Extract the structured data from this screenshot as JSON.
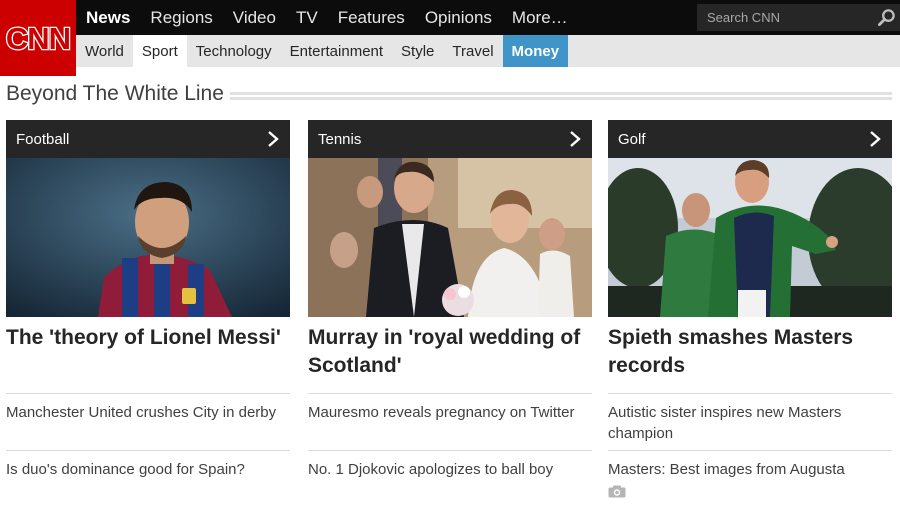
{
  "brand": {
    "logo_text": "CNN",
    "accent": "#cc0000"
  },
  "primary_nav": [
    "News",
    "Regions",
    "Video",
    "TV",
    "Features",
    "Opinions",
    "More…"
  ],
  "search": {
    "placeholder": "Search CNN"
  },
  "secondary_nav": [
    "World",
    "Sport",
    "Technology",
    "Entertainment",
    "Style",
    "Travel",
    "Money"
  ],
  "section": {
    "title": "Beyond The White Line"
  },
  "columns": [
    {
      "category": "Football",
      "headline": "The 'theory of Lionel Messi'",
      "stories": [
        "Manchester United crushes City in derby",
        "Is duo's dominance good for Spain?"
      ]
    },
    {
      "category": "Tennis",
      "headline": "Murray in 'royal wedding of Scotland'",
      "stories": [
        "Mauresmo reveals pregnancy on Twitter",
        "No. 1 Djokovic apologizes to ball boy"
      ]
    },
    {
      "category": "Golf",
      "headline": "Spieth smashes Masters records",
      "stories": [
        "Autistic sister inspires new Masters champion",
        "Masters: Best images from Augusta"
      ]
    }
  ]
}
